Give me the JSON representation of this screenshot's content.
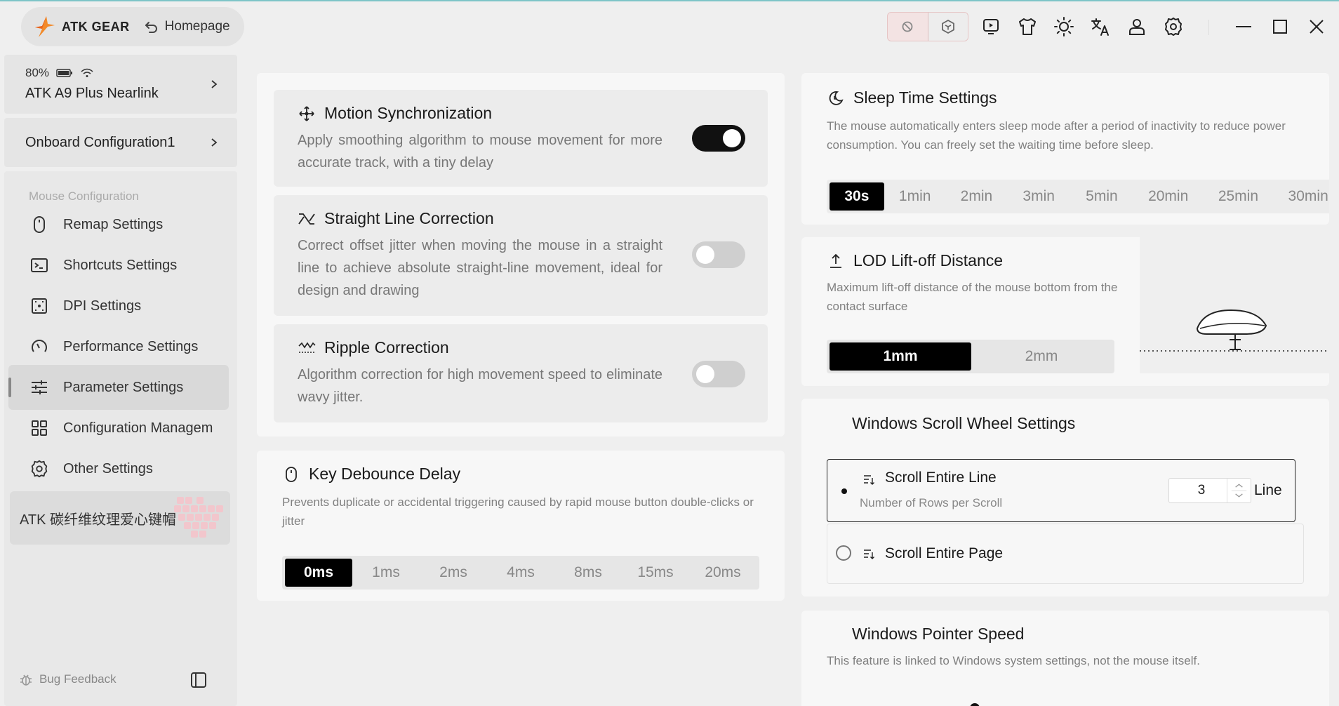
{
  "brand": {
    "name": "ATK GEAR",
    "home_label": "Homepage"
  },
  "device": {
    "battery": "80%",
    "name": "ATK A9 Plus Nearlink"
  },
  "onboard": {
    "label": "Onboard Configuration1"
  },
  "nav": {
    "section": "Mouse Configuration",
    "items": [
      {
        "label": "Remap Settings",
        "icon": "mouse-icon"
      },
      {
        "label": "Shortcuts Settings",
        "icon": "terminal-icon"
      },
      {
        "label": "DPI Settings",
        "icon": "dpi-icon"
      },
      {
        "label": "Performance Settings",
        "icon": "gauge-icon"
      },
      {
        "label": "Parameter Settings",
        "icon": "sliders-icon",
        "active": true
      },
      {
        "label": "Configuration Managem",
        "icon": "grid-icon"
      },
      {
        "label": "Other Settings",
        "icon": "gear-icon"
      }
    ]
  },
  "promo": {
    "label": "ATK 碳纤维纹理爱心键帽"
  },
  "bug": {
    "label": "Bug Feedback"
  },
  "motion": {
    "title": "Motion Synchronization",
    "desc": "Apply smoothing algorithm to mouse movement for more accurate track, with a tiny delay",
    "on": true
  },
  "straight": {
    "title": "Straight Line Correction",
    "desc": "Correct offset jitter when moving the mouse in a straight line to achieve absolute straight-line movement, ideal for design and drawing",
    "on": false
  },
  "ripple": {
    "title": "Ripple Correction",
    "desc": "Algorithm correction for high movement speed to eliminate wavy jitter.",
    "on": false
  },
  "debounce": {
    "title": "Key Debounce Delay",
    "desc": "Prevents duplicate or accidental triggering caused by rapid mouse button double-clicks or jitter",
    "options": [
      "0ms",
      "1ms",
      "2ms",
      "4ms",
      "8ms",
      "15ms",
      "20ms"
    ],
    "selected": "0ms"
  },
  "sleep": {
    "title": "Sleep Time Settings",
    "desc": "The mouse automatically enters sleep mode after a period of inactivity to reduce power consumption. You can freely set the waiting time before sleep.",
    "options": [
      "30s",
      "1min",
      "2min",
      "3min",
      "5min",
      "20min",
      "25min",
      "30min"
    ],
    "selected": "30s"
  },
  "lod": {
    "title": "LOD Lift-off Distance",
    "desc": "Maximum lift-off distance of the mouse bottom from the contact surface",
    "options": [
      "1mm",
      "2mm"
    ],
    "selected": "1mm"
  },
  "scroll": {
    "title": "Windows Scroll Wheel Settings",
    "line_label": "Scroll Entire Line",
    "line_sub": "Number of Rows per Scroll",
    "line_value": "3",
    "line_unit": "Line",
    "page_label": "Scroll Entire Page"
  },
  "pointer": {
    "title": "Windows Pointer Speed",
    "desc": "This feature is linked to Windows system settings, not the mouse itself."
  }
}
